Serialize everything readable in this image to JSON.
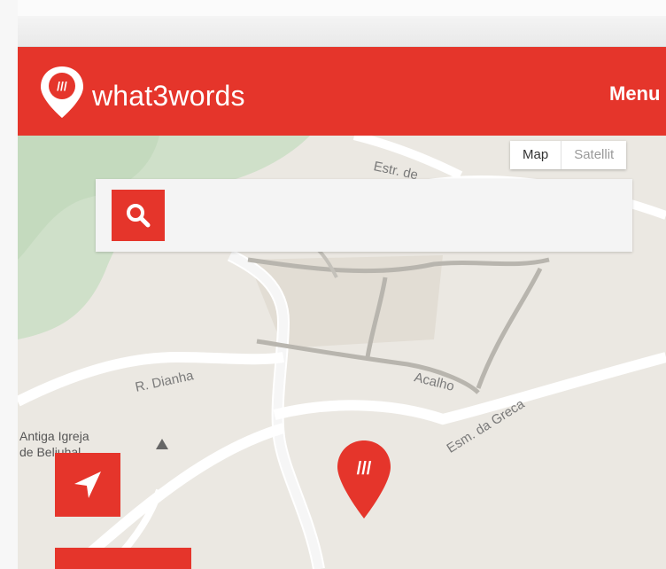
{
  "header": {
    "brand_name": "what3words",
    "menu_label": "Menu",
    "brand_color": "#e5352b",
    "logo_icon": "what3words-pin-icon"
  },
  "map_type": {
    "options": [
      "Map",
      "Satellite"
    ],
    "selected": "Map",
    "visible_labels": [
      "Map",
      "Satellit"
    ]
  },
  "search": {
    "value": "",
    "placeholder": "",
    "icon": "search-icon"
  },
  "map_labels": {
    "streets": [
      "Estr. de",
      "R. Dianha",
      "Acalho",
      "Esm. da Greca"
    ],
    "poi_line1": "Antiga Igreja",
    "poi_line2": "de Beliuhal"
  },
  "controls": {
    "locate_icon": "navigation-arrow-icon",
    "pin_icon": "what3words-map-pin-icon"
  }
}
